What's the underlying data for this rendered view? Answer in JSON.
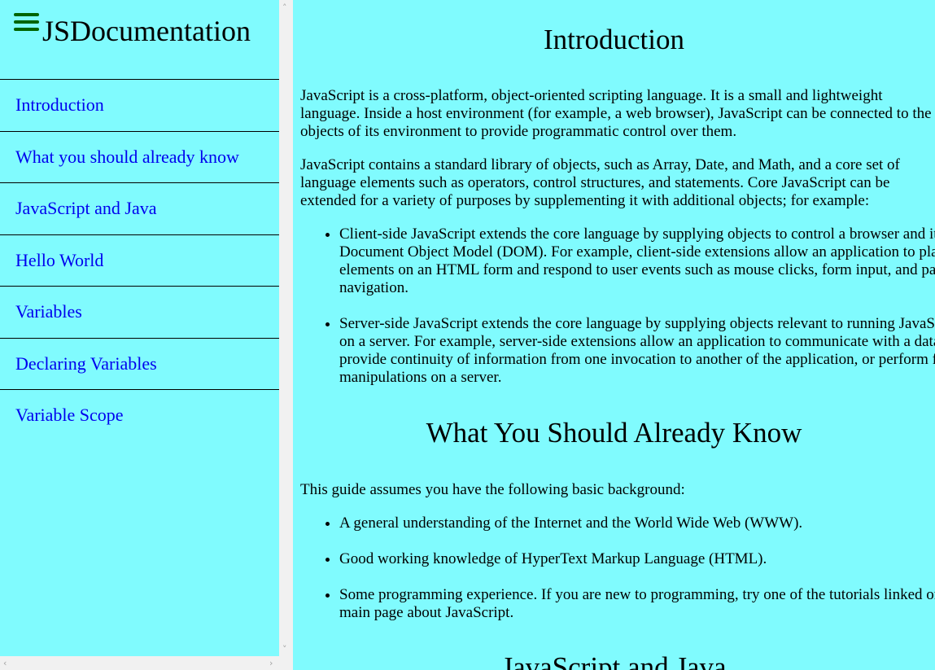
{
  "sidebar": {
    "title": "JSDocumentation",
    "items": [
      {
        "label": "Introduction"
      },
      {
        "label": "What you should already know"
      },
      {
        "label": "JavaScript and Java"
      },
      {
        "label": "Hello World"
      },
      {
        "label": "Variables"
      },
      {
        "label": "Declaring Variables"
      },
      {
        "label": "Variable Scope"
      }
    ]
  },
  "main": {
    "introduction": {
      "heading": "Introduction",
      "p1": "JavaScript is a cross-platform, object-oriented scripting language. It is a small and lightweight language. Inside a host environment (for example, a web browser), JavaScript can be connected to the objects of its environment to provide programmatic control over them.",
      "p2": "JavaScript contains a standard library of objects, such as Array, Date, and Math, and a core set of language elements such as operators, control structures, and statements. Core JavaScript can be extended for a variety of purposes by supplementing it with additional objects; for example:",
      "bullets": [
        "Client-side JavaScript extends the core language by supplying objects to control a browser and its Document Object Model (DOM). For example, client-side extensions allow an application to place elements on an HTML form and respond to user events such as mouse clicks, form input, and page navigation.",
        "Server-side JavaScript extends the core language by supplying objects relevant to running JavaScript on a server. For example, server-side extensions allow an application to communicate with a database, provide continuity of information from one invocation to another of the application, or perform file manipulations on a server."
      ]
    },
    "what_you_should_know": {
      "heading": "What You Should Already Know",
      "p1": "This guide assumes you have the following basic background:",
      "bullets": [
        "A general understanding of the Internet and the World Wide Web (WWW).",
        "Good working knowledge of HyperText Markup Language (HTML).",
        "Some programming experience. If you are new to programming, try one of the tutorials linked on the main page about JavaScript."
      ]
    },
    "javascript_and_java": {
      "heading": "JavaScript and Java"
    }
  },
  "icons": {
    "menu": "hamburger-menu-icon",
    "menu_color": "#006400",
    "link_color": "#0000ee",
    "background": "#80fbfe"
  }
}
